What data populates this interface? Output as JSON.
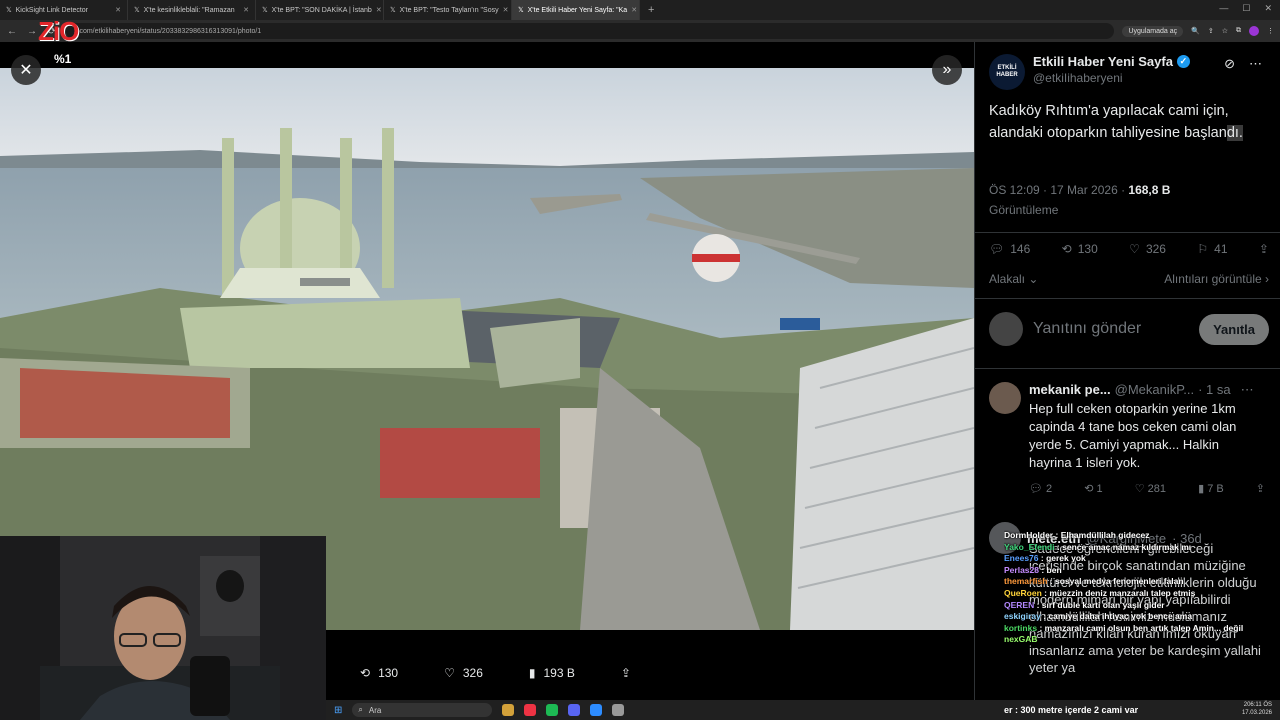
{
  "browser": {
    "tabs": [
      {
        "label": "KickSight Link Detector",
        "active": false
      },
      {
        "label": "X'te kesinlikleblali: \"Ramazan",
        "active": false
      },
      {
        "label": "X'te BPT: \"SON DAKİKA | İstanb",
        "active": false
      },
      {
        "label": "X'te BPT: \"Testo Taylan'ın \"Sosy",
        "active": false
      },
      {
        "label": "X'te Etkili Haber Yeni Sayfa: \"Ka",
        "active": true
      }
    ],
    "url": "x.com/etkilihaberyeni/status/2033832986316313091/photo/1",
    "translate_label": "Uygulamada aç"
  },
  "stream_overlay": {
    "logo": "ZiO",
    "badge": "%1"
  },
  "photo_actions": {
    "retweets": "130",
    "likes": "326",
    "views": "193 B"
  },
  "tweet": {
    "author_name": "Etkili Haber Yeni Sayfa",
    "author_handle": "@etkiIihaberyeni",
    "avatar_text": "ETKİLİ HABER",
    "text_main": "Kadıköy Rıhtım'a yapılacak cami için, alandaki otoparkın tahliyesine başlan",
    "text_highlight": "dı.",
    "time": "ÖS 12:09 · 17 Mar 2026 · ",
    "views_count": "168,8 B",
    "views_label": "Görüntüleme",
    "replies": "146",
    "retweets": "130",
    "likes": "326",
    "bookmarks": "41",
    "related_label": "Alakalı",
    "quotes_label": "Alıntıları görüntüle"
  },
  "reply_box": {
    "placeholder": "Yanıtını gönder",
    "button": "Yanıtla"
  },
  "replies": [
    {
      "name": "mekanik pe...",
      "handle": "@MekanikP...",
      "time": "· 1 sa",
      "text": "Hep full ceken otoparkin yerine 1km capinda 4 tane bos ceken cami olan yerde 5. Camiyi yapmak... Halkin hayrina 1 isleri yok.",
      "replies": "2",
      "retweets": "1",
      "likes": "281",
      "views": "7 B"
    },
    {
      "name": "mete.eth",
      "handle": "@KarginMete",
      "time": "· 36d",
      "text": "Sadece öğrencilerin girebileceği içerisinde birçok sanatından müziğine kültürel ve teknolojik etkinliklerin olduğu modern mimari bir yapı yapılabilirdi elhamdüllilah henimiz müslümanız namazınızı kılan kuran'ımızı okuyan insanlarız ama yeter be kardeşim yallahi yeter ya"
    }
  ],
  "chat": [
    {
      "user": "DormHolder",
      "msg": "Elhamdüllilah gidecez",
      "color": "#ffffff"
    },
    {
      "user": "Yako_Efendi",
      "msg": "sence amaç namaz kıldırmak mı",
      "color": "#3fd67c"
    },
    {
      "user": "Enees76",
      "msg": "gerek yok",
      "color": "#5aa0ff"
    },
    {
      "user": "Perlas28",
      "msg": "ben",
      "color": "#c58cff"
    },
    {
      "user": "themarfish",
      "msg": "sosyal medya fenomenleri falan",
      "color": "#ff9a3c"
    },
    {
      "user": "QueRoen",
      "msg": "müezzin deniz manzaralı talep etmiş",
      "color": "#ffd43b"
    },
    {
      "user": "QEREN",
      "msg": "sırf duble karti olan yaşlı gider",
      "color": "#b388ff"
    },
    {
      "user": "eskigiray",
      "msg": "camiye daha ihtiyaç yok bence ama",
      "color": "#8fd3ff"
    },
    {
      "user": "kortinks",
      "msg": "manzaralı cami olsun ben artık talep Amin... değil",
      "color": "#4cd964"
    },
    {
      "user": "nexGAB",
      "msg": "",
      "color": "#9aff6e"
    }
  ],
  "ticker": "er : 300 metre içerde 2 cami var",
  "taskbar": {
    "search": "Ara",
    "time": "206:11 ÖS",
    "date": "17.03.2026"
  }
}
